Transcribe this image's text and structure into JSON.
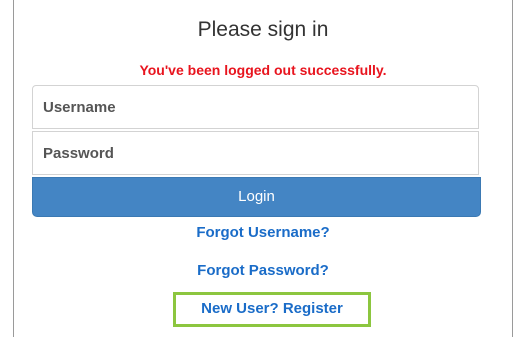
{
  "form": {
    "title": "Please sign in",
    "status_message": "You've been logged out successfully.",
    "username_placeholder": "Username",
    "password_placeholder": "Password",
    "login_label": "Login"
  },
  "links": {
    "forgot_username": "Forgot Username?",
    "forgot_password": "Forgot Password?",
    "register": "New User? Register"
  },
  "colors": {
    "status_message": "#e8141e",
    "login_button": "#4485c4",
    "link": "#1a6cc8",
    "register_highlight": "#8cc63f"
  }
}
